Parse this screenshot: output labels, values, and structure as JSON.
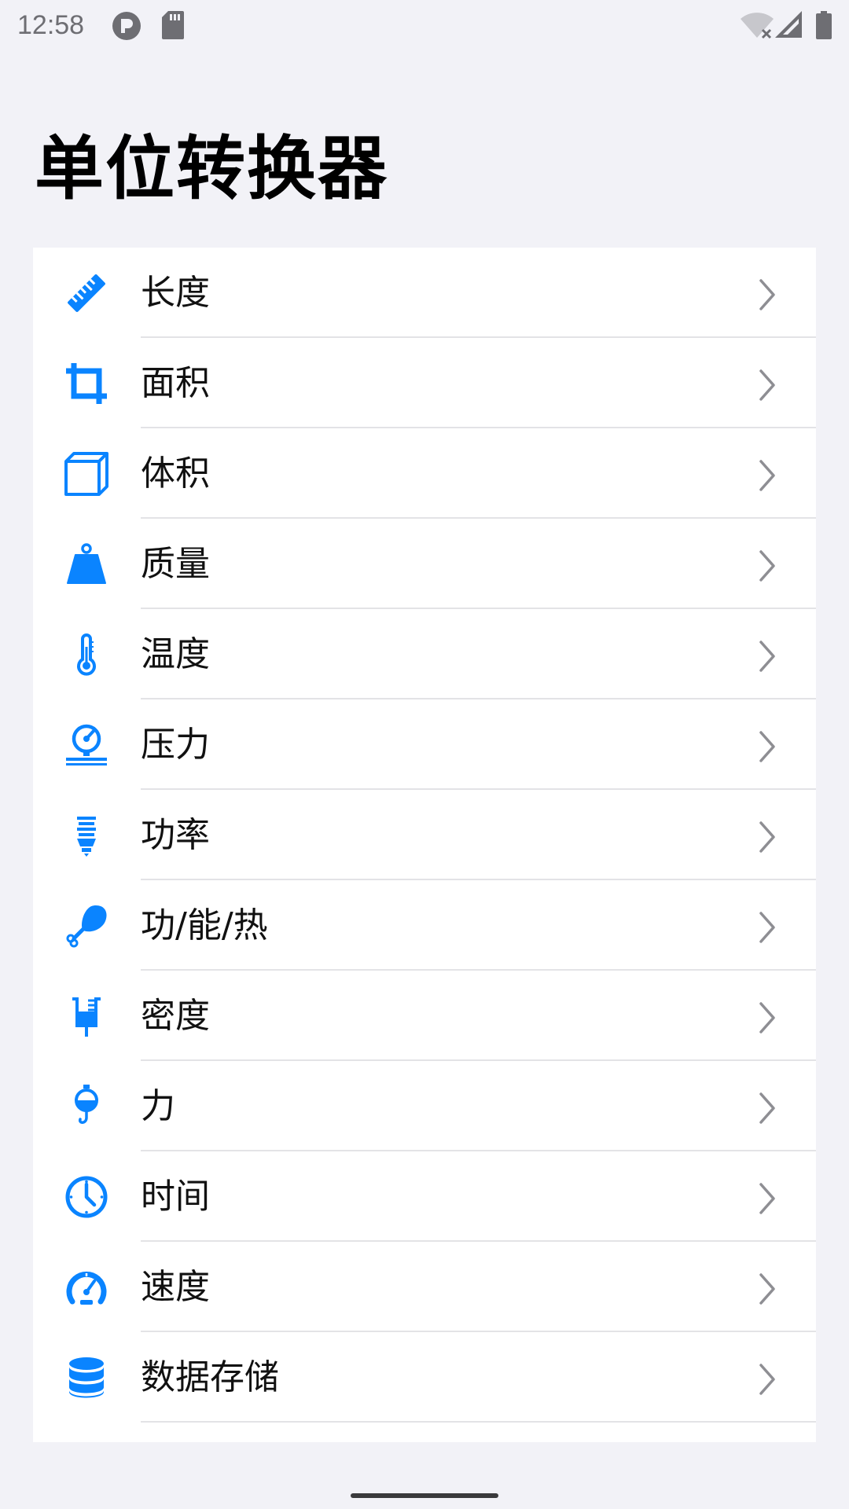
{
  "status_bar": {
    "time": "12:58",
    "icons": [
      "app-notification-icon",
      "sd-card-icon",
      "wifi-off-icon",
      "cellular-signal-icon",
      "battery-icon"
    ]
  },
  "page": {
    "title": "单位转换器"
  },
  "colors": {
    "accent": "#0a84ff",
    "background": "#f2f2f7",
    "card": "#ffffff",
    "divider": "#e3e3e6",
    "chevron": "#8e8e93"
  },
  "items": [
    {
      "label": "长度",
      "icon": "ruler-icon"
    },
    {
      "label": "面积",
      "icon": "crop-icon"
    },
    {
      "label": "体积",
      "icon": "cube-icon"
    },
    {
      "label": "质量",
      "icon": "weight-icon"
    },
    {
      "label": "温度",
      "icon": "thermometer-icon"
    },
    {
      "label": "压力",
      "icon": "pressure-gauge-icon"
    },
    {
      "label": "功率",
      "icon": "lightbulb-icon"
    },
    {
      "label": "功/能/热",
      "icon": "drumstick-icon"
    },
    {
      "label": "密度",
      "icon": "beaker-icon"
    },
    {
      "label": "力",
      "icon": "spring-scale-icon"
    },
    {
      "label": "时间",
      "icon": "clock-icon"
    },
    {
      "label": "速度",
      "icon": "speedometer-icon"
    },
    {
      "label": "数据存储",
      "icon": "database-icon"
    }
  ]
}
